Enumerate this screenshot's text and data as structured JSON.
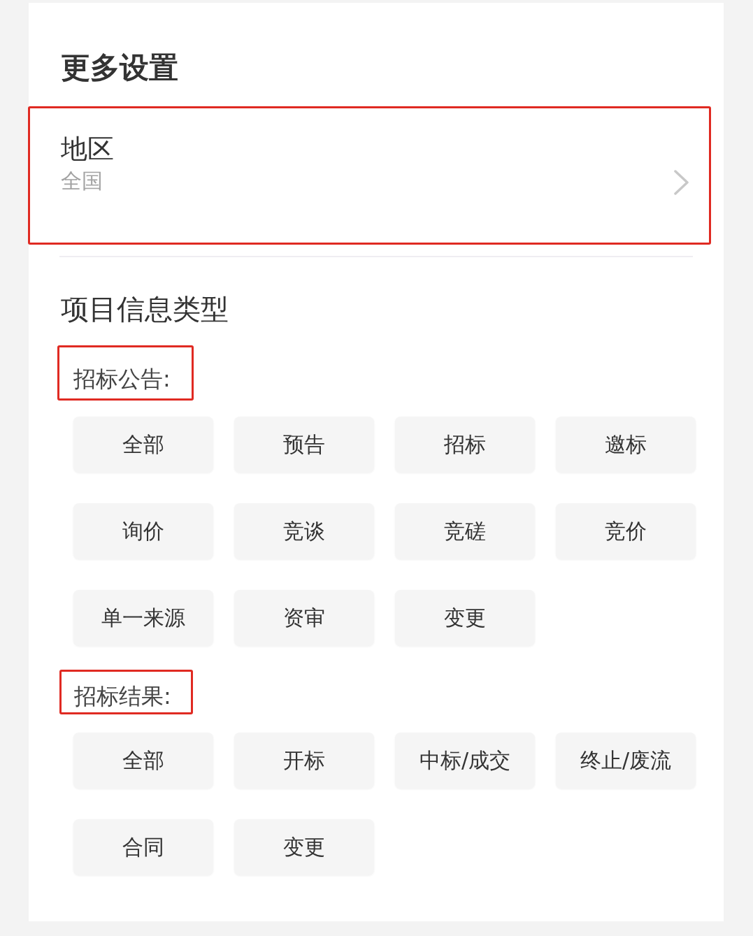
{
  "title": "更多设置",
  "region": {
    "label": "地区",
    "value": "全国",
    "highlighted": true
  },
  "project_info": {
    "title": "项目信息类型",
    "groups": [
      {
        "label": "招标公告:",
        "highlighted": true,
        "options": [
          {
            "label": "全部",
            "selected": false
          },
          {
            "label": "预告",
            "selected": false
          },
          {
            "label": "招标",
            "selected": false
          },
          {
            "label": "邀标",
            "selected": false
          },
          {
            "label": "询价",
            "selected": false
          },
          {
            "label": "竞谈",
            "selected": false
          },
          {
            "label": "竞磋",
            "selected": false
          },
          {
            "label": "竞价",
            "selected": false
          },
          {
            "label": "单一来源",
            "selected": false
          },
          {
            "label": "资审",
            "selected": false
          },
          {
            "label": "变更",
            "selected": false
          }
        ]
      },
      {
        "label": "招标结果:",
        "highlighted": true,
        "options": [
          {
            "label": "全部",
            "selected": false
          },
          {
            "label": "开标",
            "selected": false
          },
          {
            "label": "中标/成交",
            "selected": false
          },
          {
            "label": "终止/废流",
            "selected": false
          },
          {
            "label": "合同",
            "selected": false
          },
          {
            "label": "变更",
            "selected": false
          }
        ]
      }
    ]
  }
}
